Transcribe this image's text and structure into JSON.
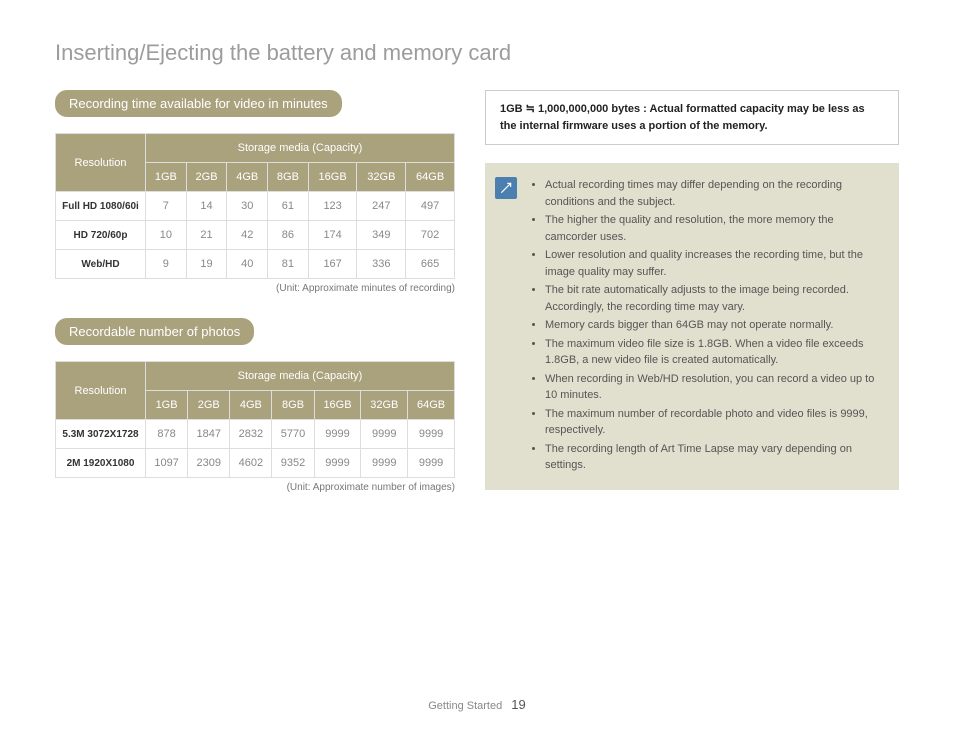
{
  "page_title": "Inserting/Ejecting the battery and memory card",
  "section1": {
    "heading": "Recording time available for video in minutes",
    "table": {
      "res_header": "Resolution",
      "cap_header": "Storage media (Capacity)",
      "columns": [
        "1GB",
        "2GB",
        "4GB",
        "8GB",
        "16GB",
        "32GB",
        "64GB"
      ],
      "rows": [
        {
          "label": "Full HD 1080/60i",
          "values": [
            "7",
            "14",
            "30",
            "61",
            "123",
            "247",
            "497"
          ]
        },
        {
          "label": "HD 720/60p",
          "values": [
            "10",
            "21",
            "42",
            "86",
            "174",
            "349",
            "702"
          ]
        },
        {
          "label": "Web/HD",
          "values": [
            "9",
            "19",
            "40",
            "81",
            "167",
            "336",
            "665"
          ]
        }
      ]
    },
    "unit": "(Unit: Approximate minutes of recording)"
  },
  "section2": {
    "heading": "Recordable number of photos",
    "table": {
      "res_header": "Resolution",
      "cap_header": "Storage media (Capacity)",
      "columns": [
        "1GB",
        "2GB",
        "4GB",
        "8GB",
        "16GB",
        "32GB",
        "64GB"
      ],
      "rows": [
        {
          "label": "5.3M 3072X1728",
          "values": [
            "878",
            "1847",
            "2832",
            "5770",
            "9999",
            "9999",
            "9999"
          ]
        },
        {
          "label": "2M 1920X1080",
          "values": [
            "1097",
            "2309",
            "4602",
            "9352",
            "9999",
            "9999",
            "9999"
          ]
        }
      ]
    },
    "unit": "(Unit: Approximate number of images)"
  },
  "info_box": "1GB ≒ 1,000,000,000 bytes : Actual formatted capacity may be less as the internal firmware uses a portion of the memory.",
  "notes": [
    "Actual recording times may differ depending on the recording conditions and the subject.",
    "The higher the quality and resolution, the more memory the camcorder uses.",
    "Lower resolution and quality increases the recording time, but the image quality may suffer.",
    "The bit rate automatically adjusts to the image being recorded. Accordingly, the recording time may vary.",
    "Memory cards bigger than 64GB may not operate normally.",
    "The maximum video file size is 1.8GB. When a video file exceeds 1.8GB, a new video file is created automatically.",
    "When recording in Web/HD resolution, you can record a video up to 10 minutes.",
    "The maximum number of recordable photo and video files is 9999, respectively.",
    "The recording length of Art Time Lapse may vary depending on settings."
  ],
  "footer": {
    "section": "Getting Started",
    "page": "19"
  }
}
